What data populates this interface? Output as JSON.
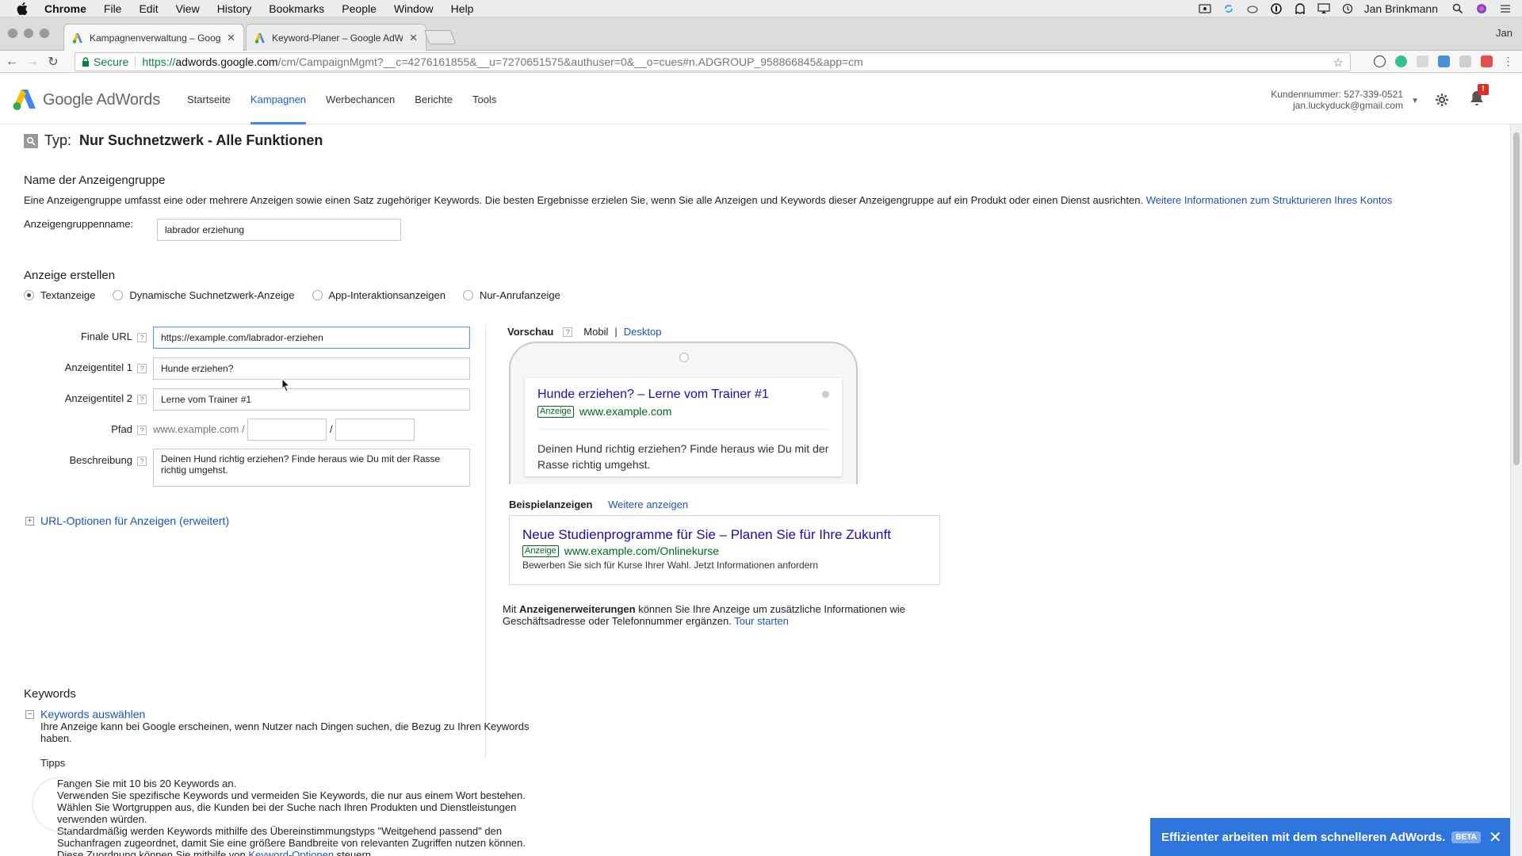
{
  "menubar": {
    "app": "Chrome",
    "items": [
      "File",
      "Edit",
      "View",
      "History",
      "Bookmarks",
      "People",
      "Window",
      "Help"
    ],
    "user": "Jan Brinkmann"
  },
  "tabs": [
    {
      "title": "Kampagnenverwaltung – Goog",
      "active": true
    },
    {
      "title": "Keyword-Planer – Google AdW",
      "active": false
    }
  ],
  "profile": "Jan",
  "address": {
    "secure_label": "Secure",
    "scheme": "https://",
    "host": "adwords.google.com",
    "path": "/cm/CampaignMgmt?__c=4276161855&__u=7270651575&authuser=0&__o=cues#n.ADGROUP_958866845&app=cm"
  },
  "header": {
    "logo_text": "Google AdWords",
    "nav": [
      "Startseite",
      "Kampagnen",
      "Werbechancen",
      "Berichte",
      "Tools"
    ],
    "active_nav": "Kampagnen",
    "customer_number": "Kundennummer: 527-339-0521",
    "email": "jan.luckyduck@gmail.com",
    "bell_badge": "!"
  },
  "type_line": {
    "label": "Typ:",
    "value": "Nur Suchnetzwerk - Alle Funktionen"
  },
  "adgroup": {
    "title": "Name der Anzeigengruppe",
    "description": "Eine Anzeigengruppe umfasst eine oder mehrere Anzeigen sowie einen Satz zugehöriger Keywords. Die besten Ergebnisse erzielen Sie, wenn Sie alle Anzeigen und Keywords dieser Anzeigengruppe auf ein Produkt oder einen Dienst ausrichten.",
    "link": "Weitere Informationen zum Strukturieren Ihres Kontos",
    "name_label": "Anzeigengruppenname:",
    "name_value": "labrador erziehung"
  },
  "create_ad": {
    "title": "Anzeige erstellen",
    "types": [
      "Textanzeige",
      "Dynamische Suchnetzwerk-Anzeige",
      "App-Interaktionsanzeigen",
      "Nur-Anrufanzeige"
    ],
    "selected_type": "Textanzeige"
  },
  "form": {
    "final_url_label": "Finale URL",
    "final_url": "https://example.com/labrador-erziehen",
    "headline1_label": "Anzeigentitel 1",
    "headline1": "Hunde erziehen?",
    "headline2_label": "Anzeigentitel 2",
    "headline2": "Lerne vom Trainer #1",
    "path_label": "Pfad",
    "path_prefix": "www.example.com /",
    "path_sep": "/",
    "path1": "",
    "path2": "",
    "description_label": "Beschreibung",
    "description": "Deinen Hund richtig erziehen? Finde heraus wie Du mit der Rasse richtig umgehst.",
    "help_glyph": "?"
  },
  "url_options": {
    "label": "URL-Optionen für Anzeigen (erweitert)",
    "glyph": "+"
  },
  "preview": {
    "label": "Vorschau",
    "mobile": "Mobil",
    "pipe": "|",
    "desktop": "Desktop",
    "ad_title": "Hunde erziehen? – Lerne vom Trainer #1",
    "ad_badge": "Anzeige",
    "ad_url": "www.example.com",
    "ad_desc": "Deinen Hund richtig erziehen? Finde heraus wie Du mit der Rasse richtig umgehst."
  },
  "examples": {
    "label": "Beispielanzeigen",
    "more": "Weitere anzeigen",
    "title": "Neue Studienprogramme für Sie – Planen Sie für Ihre Zukunft",
    "badge": "Anzeige",
    "url": "www.example.com/Onlinekurse",
    "desc": "Bewerben Sie sich für Kurse Ihrer Wahl. Jetzt Informationen anfordern"
  },
  "extensions_note": {
    "prefix": "Mit ",
    "bold": "Anzeigenerweiterungen",
    "text": " können Sie Ihre Anzeige um zusätzliche Informationen wie Geschäftsadresse oder Telefonnummer ergänzen. ",
    "link": "Tour starten"
  },
  "keywords": {
    "title": "Keywords",
    "toggle": "Keywords auswählen",
    "toggle_glyph": "−",
    "description": "Ihre Anzeige kann bei Google erscheinen, wenn Nutzer nach Dingen suchen, die Bezug zu Ihren Keywords haben.",
    "tips_title": "Tipps",
    "tips": [
      "Fangen Sie mit 10 bis 20 Keywords an.",
      "Verwenden Sie spezifische Keywords und vermeiden Sie Keywords, die nur aus einem Wort bestehen.",
      "Wählen Sie Wortgruppen aus, die Kunden bei der Suche nach Ihren Produkten und Dienstleistungen verwenden würden.",
      "Standardmäßig werden Keywords mithilfe des Übereinstimmungstyps \"Weitgehend passend\" den Suchanfragen zugeordnet, damit Sie eine größere Bandbreite von relevanten Zugriffen nutzen können."
    ],
    "last_tip_prefix": "Diese Zuordnung können Sie mithilfe von ",
    "last_tip_link": "Keyword-Optionen",
    "last_tip_suffix": " steuern."
  },
  "promo": {
    "text": "Effizienter arbeiten mit dem schnelleren AdWords.",
    "beta": "BETA",
    "close": "✕"
  },
  "colors": {
    "accent": "#4285f4",
    "link": "#1a55b5",
    "ad_title": "#1a0dab",
    "ad_url": "#006621",
    "promo_bg": "#2d74dc"
  }
}
